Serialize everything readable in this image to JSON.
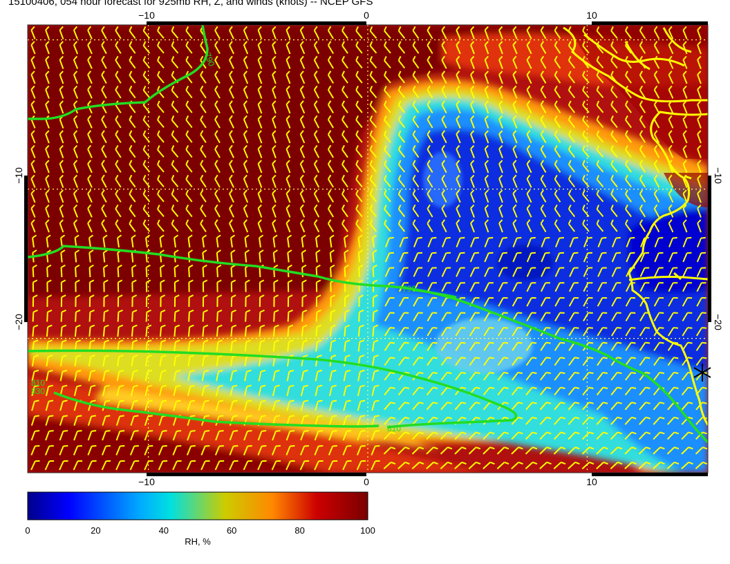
{
  "title": "15100406, 054 hour forecast for 925mb RH, Z, and winds (knots) -- NCEP GFS",
  "map": {
    "lon_range": [
      -15.5,
      15.5
    ],
    "lat_range": [
      -29,
      1
    ],
    "lon_ticks": [
      "−10",
      "0",
      "10"
    ],
    "lon_tick_values": [
      -10,
      0,
      10
    ],
    "lat_ticks": [
      "−10",
      "−20"
    ],
    "lat_tick_values": [
      -10,
      -20
    ],
    "contour_labels": [
      "790",
      "790",
      "810",
      "830",
      "810"
    ],
    "colors": {
      "coast": "#ffff00",
      "contour": "#22dd22",
      "barbs": "#ffff00",
      "grid": "#ffff66"
    }
  },
  "colorbar": {
    "ticks": [
      "0",
      "20",
      "40",
      "60",
      "80",
      "100"
    ],
    "tick_values": [
      0,
      20,
      40,
      60,
      80,
      100
    ],
    "label": "RH, %",
    "stops": [
      "#00008b",
      "#0000ff",
      "#00aaff",
      "#00e0e0",
      "#cccc00",
      "#ff8800",
      "#cc0000",
      "#7a0000"
    ]
  }
}
